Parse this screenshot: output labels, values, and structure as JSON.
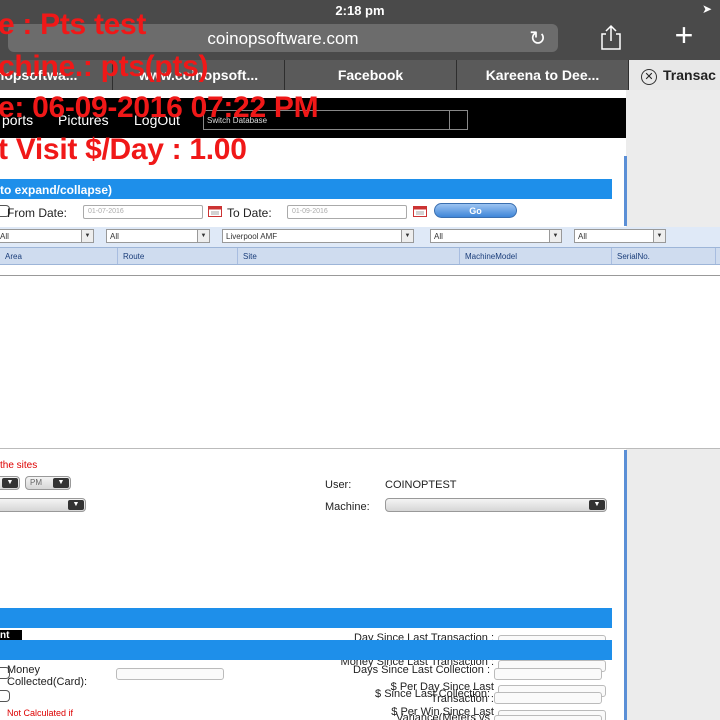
{
  "status_bar": {
    "time": "2:18 pm"
  },
  "browser": {
    "url": "coinopsoftware.com",
    "tabs": [
      {
        "label": "coinopsoftwa..."
      },
      {
        "label": "www.coinopsoft..."
      },
      {
        "label": "Facebook"
      },
      {
        "label": "Kareena to Dee..."
      },
      {
        "label": "Transac"
      }
    ]
  },
  "menu": {
    "items": [
      "ports",
      "Pictures",
      "LogOut"
    ],
    "switch_db": "Switch Database"
  },
  "top_panel": {
    "header": "to expand/collapse)",
    "from_label": "From Date:",
    "from_value": "01-07-2016",
    "to_label": "To Date:",
    "to_value": "01-09-2016",
    "go": "Go"
  },
  "filters": [
    "All",
    "All",
    "Liverpool AMF",
    "All",
    "All"
  ],
  "columns": [
    "Area",
    "Route",
    "Site",
    "MachineModel",
    "SerialNo."
  ],
  "bottom": {
    "sites_note": "the sites",
    "ampm": "PM",
    "user_label": "User:",
    "user_value": "COINOPTEST",
    "machine_label": "Machine:",
    "chip": "nt",
    "day_since": "Day Since Last Transaction :",
    "money_since": "Money Since Last Transaction :",
    "per_day": "$ Per Day Since Last Transaction :",
    "per_win": "$ Per Win Since Last Transaction :",
    "money_collected": "Money Collected(Card):",
    "days_since_coll": "Days Since Last Collection :",
    "dollar_since_coll": "$ Since Last Collection:",
    "variance": "Variance(Meters vs",
    "not_calc": "Not Calculated if"
  },
  "overlay": {
    "line1": "e : Pts test",
    "line2": "chine.: pts(pts)",
    "line3": "e: 06-09-2016 07:22 PM",
    "line4": "t Visit $/Day : 1.00"
  },
  "colors": {
    "overlay_red": "#f01818",
    "header_blue": "#1e8fea"
  }
}
